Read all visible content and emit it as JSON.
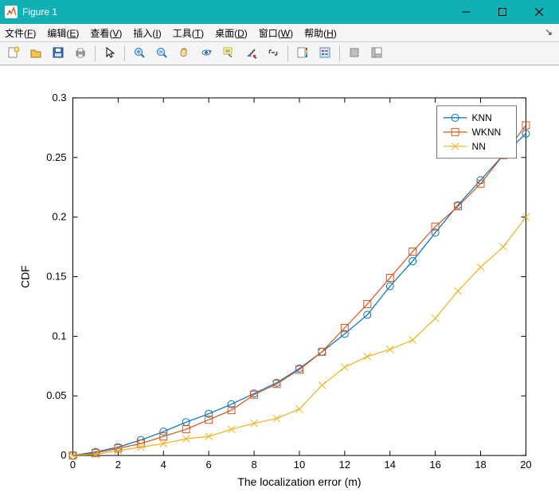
{
  "window": {
    "title": "Figure 1"
  },
  "menubar": {
    "items": [
      {
        "label": "文件(",
        "mn": "F",
        "tail": ")"
      },
      {
        "label": "编辑(",
        "mn": "E",
        "tail": ")"
      },
      {
        "label": "查看(",
        "mn": "V",
        "tail": ")"
      },
      {
        "label": "插入(",
        "mn": "I",
        "tail": ")"
      },
      {
        "label": "工具(",
        "mn": "T",
        "tail": ")"
      },
      {
        "label": "桌面(",
        "mn": "D",
        "tail": ")"
      },
      {
        "label": "窗口(",
        "mn": "W",
        "tail": ")"
      },
      {
        "label": "帮助(",
        "mn": "H",
        "tail": ")"
      }
    ]
  },
  "toolbar_icons": {
    "new": "new-figure-icon",
    "open": "open-file-icon",
    "save": "save-icon",
    "print": "print-icon",
    "pointer": "pointer-icon",
    "zoom_in": "zoom-in-icon",
    "zoom_out": "zoom-out-icon",
    "pan": "pan-icon",
    "rotate": "rotate-3d-icon",
    "datacursor": "data-cursor-icon",
    "brush": "brush-icon",
    "link": "link-icon",
    "colorbar": "colorbar-icon",
    "legend": "legend-icon",
    "hide_tools": "hide-plot-tools-icon",
    "show_tools": "show-plot-tools-icon"
  },
  "chart_data": {
    "type": "line",
    "xlabel": "The localization error (m)",
    "ylabel": "CDF",
    "xlim": [
      0,
      20
    ],
    "ylim": [
      0,
      0.3
    ],
    "xticks": [
      0,
      2,
      4,
      6,
      8,
      10,
      12,
      14,
      16,
      18,
      20
    ],
    "yticks": [
      0,
      0.05,
      0.1,
      0.15,
      0.2,
      0.25,
      0.3
    ],
    "x": [
      0,
      1,
      2,
      3,
      4,
      5,
      6,
      7,
      8,
      9,
      10,
      11,
      12,
      13,
      14,
      15,
      16,
      17,
      18,
      19,
      20
    ],
    "legend": {
      "items": [
        "KNN",
        "WKNN",
        "NN"
      ],
      "position": "northeast"
    },
    "series": [
      {
        "name": "KNN",
        "color": "#0072BD",
        "marker": "o",
        "values": [
          0.0,
          0.003,
          0.007,
          0.013,
          0.02,
          0.028,
          0.035,
          0.043,
          0.052,
          0.061,
          0.073,
          0.087,
          0.102,
          0.118,
          0.142,
          0.163,
          0.187,
          0.21,
          0.231,
          0.252,
          0.27
        ]
      },
      {
        "name": "WKNN",
        "color": "#D95319",
        "marker": "s",
        "values": [
          0.0,
          0.002,
          0.006,
          0.01,
          0.016,
          0.022,
          0.03,
          0.038,
          0.051,
          0.06,
          0.072,
          0.087,
          0.107,
          0.127,
          0.149,
          0.171,
          0.192,
          0.209,
          0.228,
          0.252,
          0.277
        ]
      },
      {
        "name": "NN",
        "color": "#EDB120",
        "marker": "x",
        "values": [
          0.0,
          0.001,
          0.004,
          0.007,
          0.01,
          0.014,
          0.016,
          0.022,
          0.027,
          0.031,
          0.039,
          0.059,
          0.074,
          0.083,
          0.089,
          0.097,
          0.115,
          0.138,
          0.158,
          0.175,
          0.2
        ]
      }
    ]
  }
}
